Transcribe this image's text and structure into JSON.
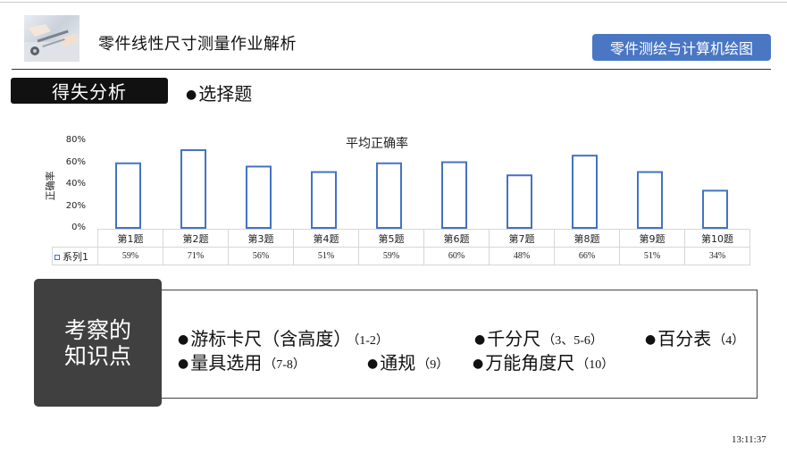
{
  "header": {
    "title": "零件线性尺寸测量作业解析",
    "course_badge": "零件测绘与计算机绘图"
  },
  "section": {
    "tag": "得失分析",
    "subtitle": "选择题"
  },
  "chart_data": {
    "type": "bar",
    "title": "平均正确率",
    "ylabel": "正确率",
    "xlabel": "",
    "ylim": [
      0,
      80
    ],
    "yticks": [
      "80%",
      "60%",
      "40%",
      "20%",
      "0%"
    ],
    "grid": false,
    "categories": [
      "第1题",
      "第2题",
      "第3题",
      "第4题",
      "第5题",
      "第6题",
      "第7题",
      "第8题",
      "第9题",
      "第10题"
    ],
    "series": [
      {
        "name": "系列1",
        "values": [
          59,
          71,
          56,
          51,
          59,
          60,
          48,
          66,
          51,
          34
        ],
        "labels": [
          "59%",
          "71%",
          "56%",
          "51%",
          "59%",
          "60%",
          "48%",
          "66%",
          "51%",
          "34%"
        ],
        "color": "#4472c4"
      }
    ]
  },
  "knowledge": {
    "heading_line1": "考察的",
    "heading_line2": "知识点",
    "points": [
      {
        "name": "游标卡尺（含高度）",
        "ref": "（1-2）"
      },
      {
        "name": "千分尺",
        "ref": "（3、5-6）"
      },
      {
        "name": "百分表",
        "ref": "（4）"
      },
      {
        "name": "量具选用",
        "ref": "（7-8）"
      },
      {
        "name": "通规",
        "ref": "（9）"
      },
      {
        "name": "万能角度尺",
        "ref": "（10）"
      }
    ]
  },
  "footer": {
    "time": "13:11:37"
  }
}
